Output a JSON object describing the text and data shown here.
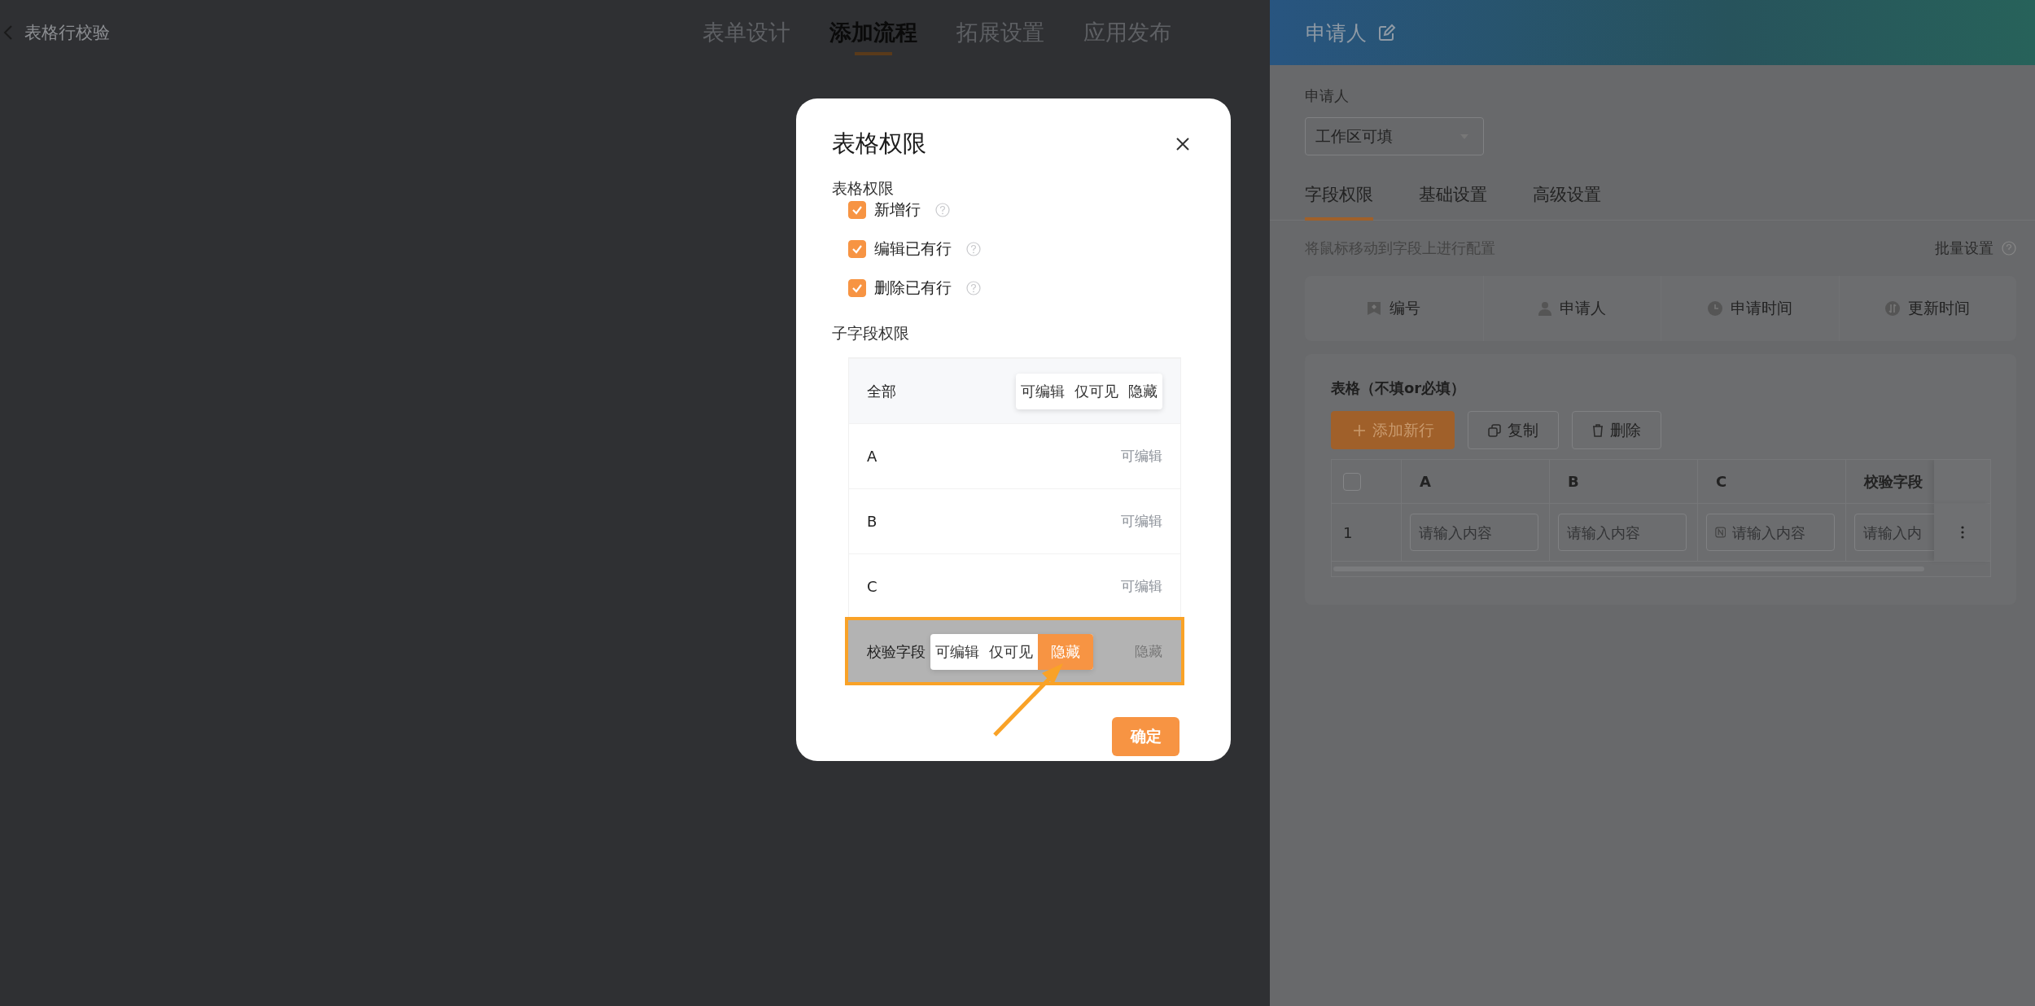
{
  "top_bar": {
    "back_label": "表格行校验",
    "steps": [
      {
        "label": "表单设计",
        "selected": false
      },
      {
        "label": "添加流程",
        "selected": true
      },
      {
        "label": "拓展设置",
        "selected": false
      },
      {
        "label": "应用发布",
        "selected": false
      }
    ]
  },
  "modal": {
    "title": "表格权限",
    "section_label": "表格权限",
    "permissions": [
      {
        "label": "新增行",
        "checked": true
      },
      {
        "label": "编辑已有行",
        "checked": true
      },
      {
        "label": "删除已有行",
        "checked": true
      }
    ],
    "subfield_label": "子字段权限",
    "subfields": [
      {
        "kind": "all",
        "name": "全部",
        "highlighted": false,
        "options": [
          {
            "label": "可编辑",
            "selected": false
          },
          {
            "label": "仅可见",
            "selected": false
          },
          {
            "label": "隐藏",
            "selected": false
          }
        ]
      },
      {
        "kind": "field",
        "name": "A",
        "value": "可编辑",
        "highlighted": false
      },
      {
        "kind": "field",
        "name": "B",
        "value": "可编辑",
        "highlighted": false
      },
      {
        "kind": "field",
        "name": "C",
        "value": "可编辑",
        "highlighted": false
      },
      {
        "kind": "field",
        "name": "校验字段",
        "value": "隐藏",
        "highlighted": true,
        "options": [
          {
            "label": "可编辑",
            "selected": false
          },
          {
            "label": "仅可见",
            "selected": false
          },
          {
            "label": "隐藏",
            "selected": true
          }
        ]
      }
    ],
    "confirm": "确定"
  },
  "right_panel": {
    "header_title": "申请人",
    "field_label": "申请人",
    "select_value": "工作区可填",
    "tabs": [
      {
        "label": "字段权限",
        "selected": true
      },
      {
        "label": "基础设置",
        "selected": false
      },
      {
        "label": "高级设置",
        "selected": false
      }
    ],
    "hint": "将鼠标移动到字段上进行配置",
    "batch_label": "批量设置",
    "system_fields": [
      {
        "kind": "number",
        "label": "编号"
      },
      {
        "kind": "person",
        "label": "申请人"
      },
      {
        "kind": "clock",
        "label": "申请时间"
      },
      {
        "kind": "update",
        "label": "更新时间"
      }
    ],
    "table_card": {
      "title": "表格（不填or必填）",
      "buttons": [
        {
          "kind": "add",
          "label": "添加新行"
        },
        {
          "kind": "copy",
          "label": "复制"
        },
        {
          "kind": "delete",
          "label": "删除"
        }
      ],
      "select_all_checked": false,
      "columns": [
        "A",
        "B",
        "C",
        "校验字段"
      ],
      "rows": [
        {
          "index": "1",
          "cells": [
            {
              "kind": "text",
              "placeholder": "请输入内容"
            },
            {
              "kind": "text",
              "placeholder": "请输入内容"
            },
            {
              "kind": "number",
              "placeholder": "请输入内容"
            },
            {
              "kind": "text",
              "placeholder": "请输入内"
            }
          ]
        }
      ]
    }
  }
}
